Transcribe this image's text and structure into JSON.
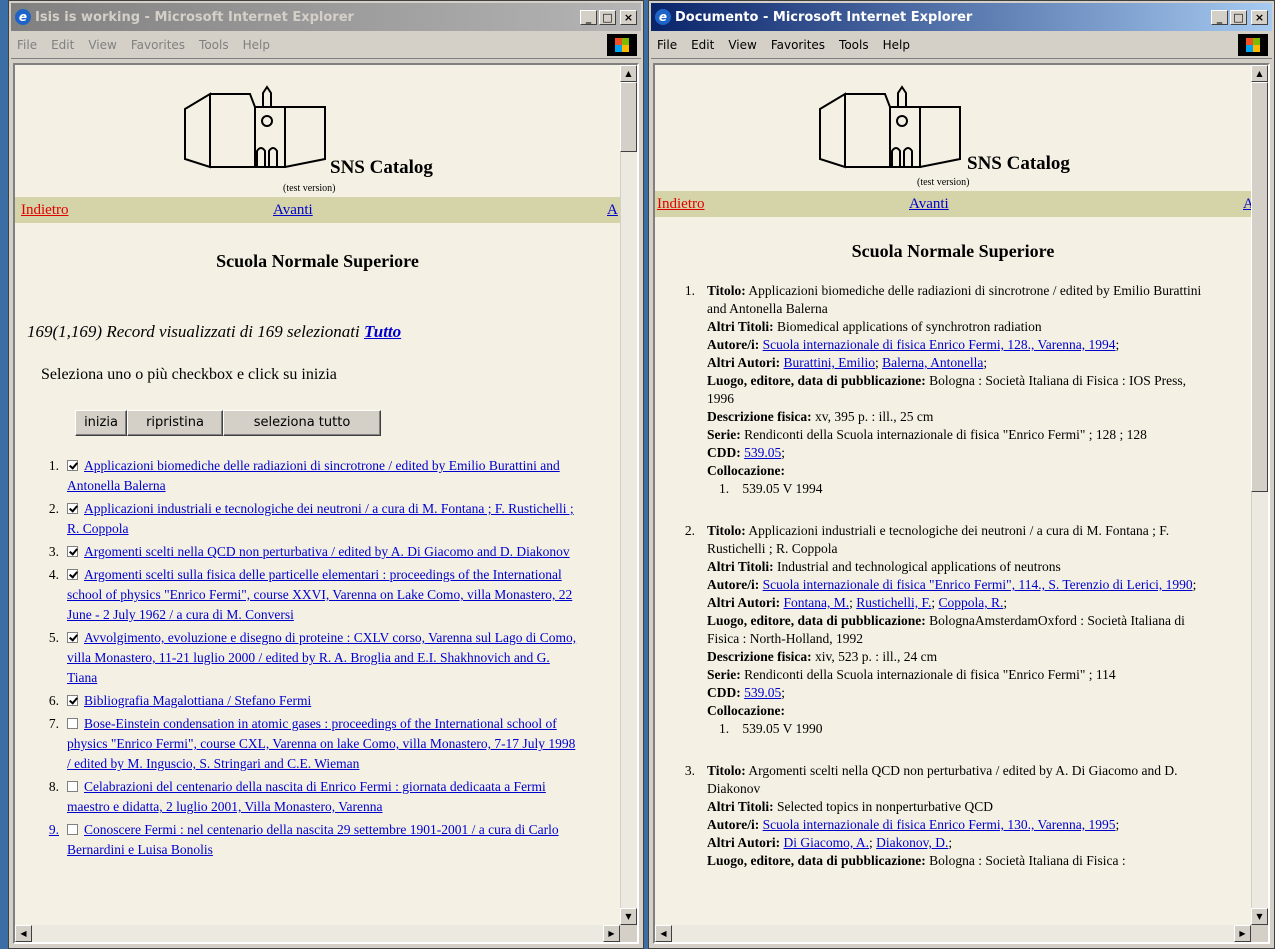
{
  "left_window": {
    "title": "Isis is working - Microsoft Internet Explorer",
    "menu": [
      "File",
      "Edit",
      "View",
      "Favorites",
      "Tools",
      "Help"
    ],
    "logo_title": "SNS Catalog",
    "logo_subtitle": "(test version)",
    "nav": {
      "back": "Indietro",
      "next": "Avanti",
      "cut": "A"
    },
    "heading": "Scuola Normale Superiore",
    "records_text": "169(1,169) Record visualizzati di 169 selezionati",
    "records_link": "Tutto",
    "instruction": "Seleziona uno o più checkbox e click su inizia",
    "buttons": {
      "start": "inizia",
      "reset": "ripristina",
      "select_all": "seleziona tutto"
    },
    "results": [
      {
        "num": "1.",
        "checked": true,
        "text": "Applicazioni biomediche delle radiazioni di sincrotrone / edited by Emilio Burattini and Antonella Balerna"
      },
      {
        "num": "2.",
        "checked": true,
        "text": "Applicazioni industriali e tecnologiche dei neutroni / a cura di M. Fontana ; F. Rustichelli ; R. Coppola"
      },
      {
        "num": "3.",
        "checked": true,
        "text": "Argomenti scelti nella QCD non perturbativa / edited by A. Di Giacomo and D. Diakonov"
      },
      {
        "num": "4.",
        "checked": true,
        "text": "Argomenti scelti sulla fisica delle particelle elementari : proceedings of the International school of physics \"Enrico Fermi\", course XXVI, Varenna on Lake Como, villa Monastero, 22 June - 2 July 1962 / a cura di M. Conversi"
      },
      {
        "num": "5.",
        "checked": true,
        "text": "Avvolgimento, evoluzione e disegno di proteine : CXLV corso, Varenna sul Lago di Como, villa Monastero, 11-21 luglio 2000 / edited by R. A. Broglia and E.I. Shakhnovich and G. Tiana"
      },
      {
        "num": "6.",
        "checked": true,
        "text": "Bibliografia Magalottiana / Stefano Fermi"
      },
      {
        "num": "7.",
        "checked": false,
        "text": "Bose-Einstein condensation in atomic gases : proceedings of the International school of physics \"Enrico Fermi\", course CXL, Varenna on lake Como, villa Monastero, 7-17 July 1998 / edited by M. Inguscio, S. Stringari and C.E. Wieman"
      },
      {
        "num": "8.",
        "checked": false,
        "text": "Celabrazioni del centenario della nascita di Enrico Fermi : giornata dedicaata a Fermi maestro e didatta, 2 luglio 2001, Villa Monastero, Varenna"
      },
      {
        "num": "9.",
        "checked": false,
        "text": "Conoscere Fermi : nel centenario della nascita 29 settembre 1901-2001 / a cura di Carlo Bernardini e Luisa Bonolis"
      }
    ]
  },
  "right_window": {
    "title": "Documento - Microsoft Internet Explorer",
    "menu": [
      "File",
      "Edit",
      "View",
      "Favorites",
      "Tools",
      "Help"
    ],
    "logo_title": "SNS Catalog",
    "logo_subtitle": "(test version)",
    "nav": {
      "back": "Indietro",
      "next": "Avanti",
      "cut": "A"
    },
    "heading": "Scuola Normale Superiore",
    "labels": {
      "titolo": "Titolo:",
      "altri_titoli": "Altri Titoli:",
      "autore": "Autore/i:",
      "altri_autori": "Altri Autori:",
      "luogo": "Luogo, editore, data di pubblicazione:",
      "descrizione": "Descrizione fisica:",
      "serie": "Serie:",
      "cdd": "CDD:",
      "collocazione": "Collocazione:"
    },
    "records": [
      {
        "num": "1.",
        "titolo": "Applicazioni biomediche delle radiazioni di sincrotrone / edited by Emilio Burattini and Antonella Balerna",
        "altri_titoli": "Biomedical applications of synchrotron radiation",
        "autore": "Scuola internazionale di fisica Enrico Fermi, 128., Varenna, 1994",
        "altri_autori": [
          "Burattini, Emilio",
          "Balerna, Antonella"
        ],
        "luogo": "Bologna : Società Italiana di Fisica : IOS Press, 1996",
        "descrizione": "xv, 395 p. : ill., 25 cm",
        "serie": "Rendiconti della Scuola internazionale di fisica \"Enrico Fermi\" ; 128 ; 128",
        "cdd": "539.05",
        "collocazione_num": "1.",
        "collocazione": "539.05 V 1994"
      },
      {
        "num": "2.",
        "titolo": "Applicazioni industriali e tecnologiche dei neutroni / a cura di M. Fontana ; F. Rustichelli ; R. Coppola",
        "altri_titoli": "Industrial and technological applications of neutrons",
        "autore": "Scuola internazionale di fisica \"Enrico Fermi\", 114., S. Terenzio di Lerici, 1990",
        "altri_autori": [
          "Fontana, M.",
          "Rustichelli, F.",
          "Coppola, R."
        ],
        "luogo": "BolognaAmsterdamOxford : Società Italiana di Fisica : North-Holland, 1992",
        "descrizione": "xiv, 523 p. : ill., 24 cm",
        "serie": "Rendiconti della Scuola internazionale di fisica \"Enrico Fermi\" ; 114",
        "cdd": "539.05",
        "collocazione_num": "1.",
        "collocazione": "539.05 V 1990"
      },
      {
        "num": "3.",
        "titolo": "Argomenti scelti nella QCD non perturbativa / edited by A. Di Giacomo and D. Diakonov",
        "altri_titoli": "Selected topics in nonperturbative QCD",
        "autore": "Scuola internazionale di fisica Enrico Fermi, 130., Varenna, 1995",
        "altri_autori": [
          "Di Giacomo, A.",
          "Diakonov, D."
        ],
        "luogo": "Bologna : Società Italiana di Fisica :"
      }
    ]
  }
}
